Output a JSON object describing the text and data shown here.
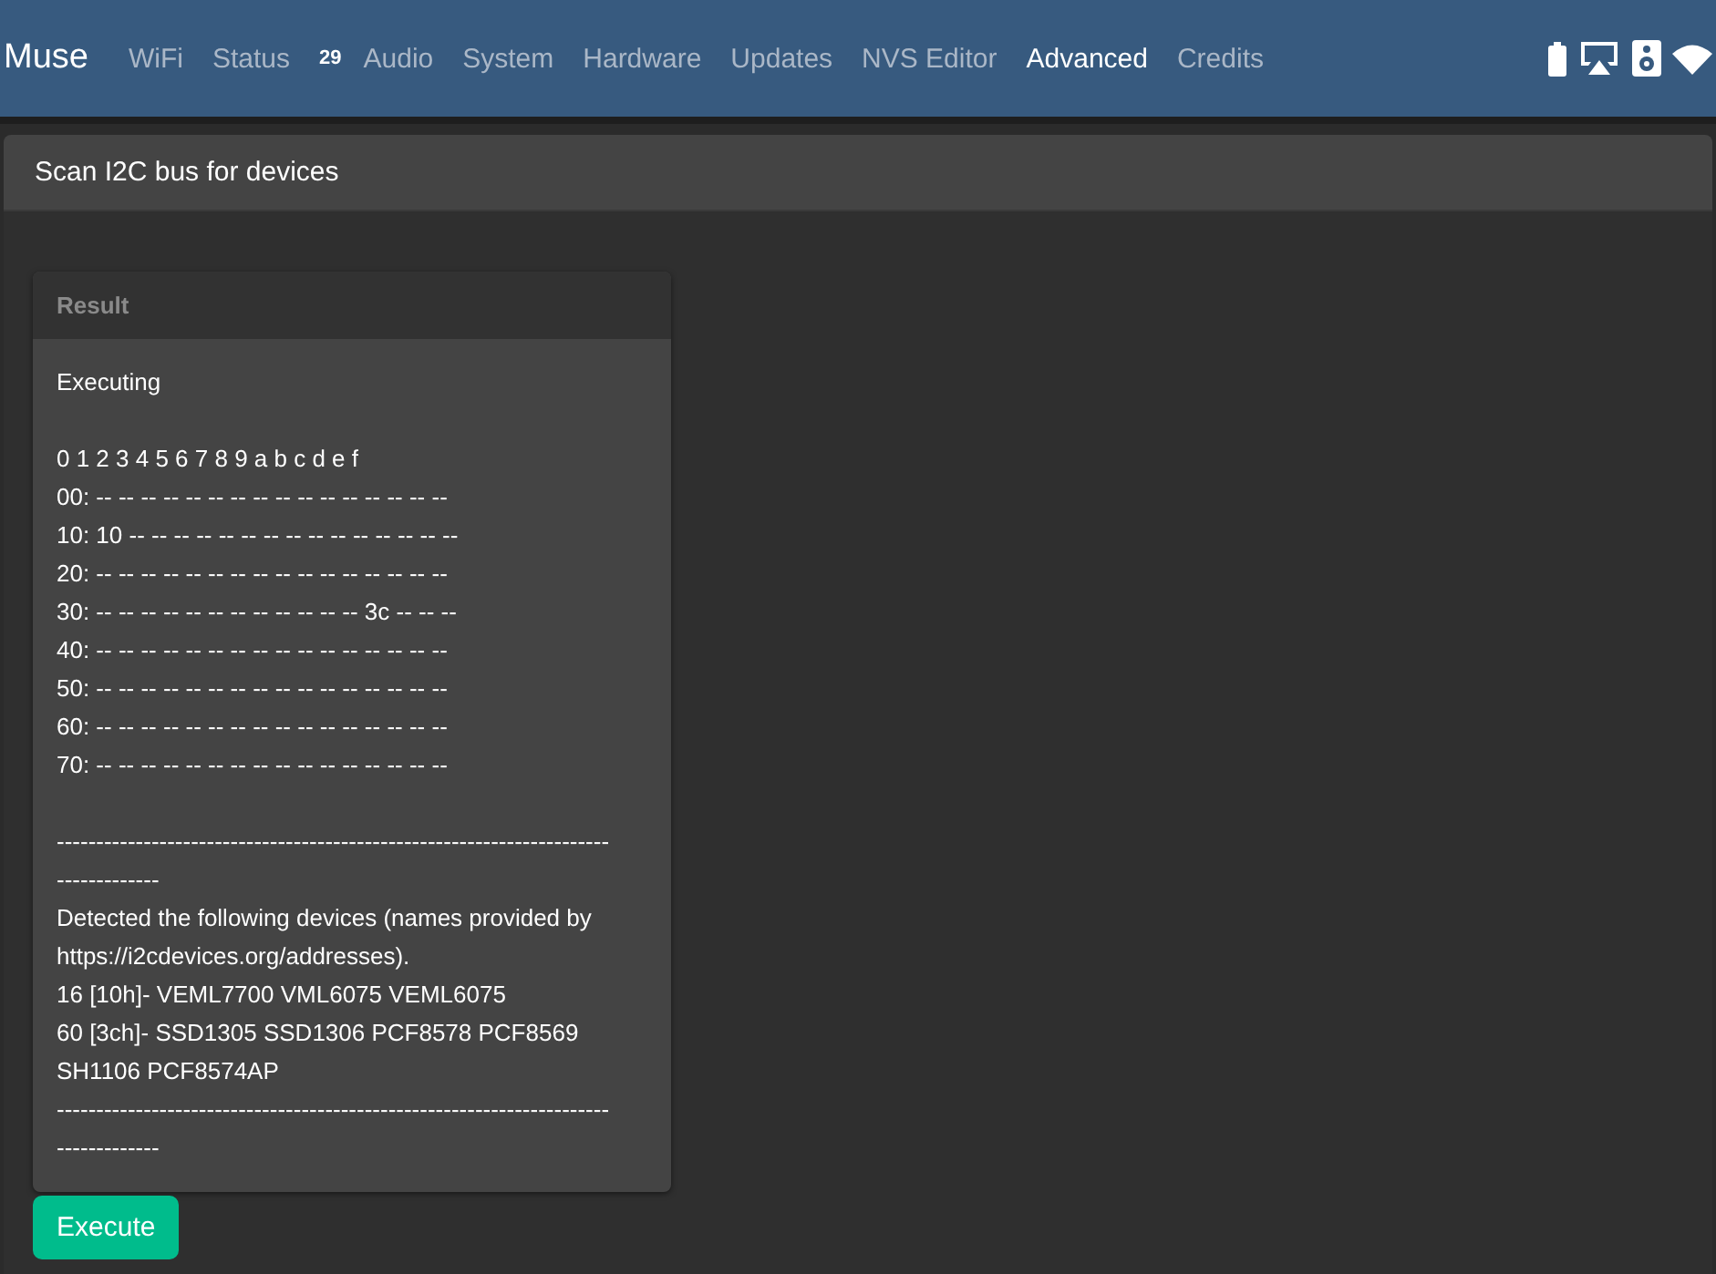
{
  "navbar": {
    "brand": "Muse",
    "tabs": [
      {
        "label": "WiFi",
        "selected": false
      },
      {
        "label": "Status",
        "badge": "29",
        "selected": false
      },
      {
        "label": "Audio",
        "selected": false
      },
      {
        "label": "System",
        "selected": false
      },
      {
        "label": "Hardware",
        "selected": false
      },
      {
        "label": "Updates",
        "selected": false
      },
      {
        "label": "NVS Editor",
        "selected": false
      },
      {
        "label": "Advanced",
        "selected": true
      },
      {
        "label": "Credits",
        "selected": false
      }
    ]
  },
  "panel": {
    "title": "Scan I2C bus for devices"
  },
  "result": {
    "title": "Result",
    "paragraphs": [
      [
        "Executing"
      ],
      [
        "0 1 2 3 4 5 6 7 8 9 a b c d e f",
        "00: -- -- -- -- -- -- -- -- -- -- -- -- -- -- -- --",
        "10: 10 -- -- -- -- -- -- -- -- -- -- -- -- -- -- --",
        "20: -- -- -- -- -- -- -- -- -- -- -- -- -- -- -- --",
        "30: -- -- -- -- -- -- -- -- -- -- -- -- 3c -- -- --",
        "40: -- -- -- -- -- -- -- -- -- -- -- -- -- -- -- --",
        "50: -- -- -- -- -- -- -- -- -- -- -- -- -- -- -- --",
        "60: -- -- -- -- -- -- -- -- -- -- -- -- -- -- -- --",
        "70: -- -- -- -- -- -- -- -- -- -- -- -- -- -- -- --"
      ],
      [
        "-----------------------------------------------------------------------------------",
        "Detected the following devices (names provided by https://i2cdevices.org/addresses).",
        "16 [10h]- VEML7700 VML6075 VEML6075",
        "60 [3ch]- SSD1305 SSD1306 PCF8578 PCF8569 SH1106 PCF8574AP",
        "-----------------------------------------------------------------------------------"
      ]
    ]
  },
  "execute_button": {
    "label": "Execute"
  }
}
